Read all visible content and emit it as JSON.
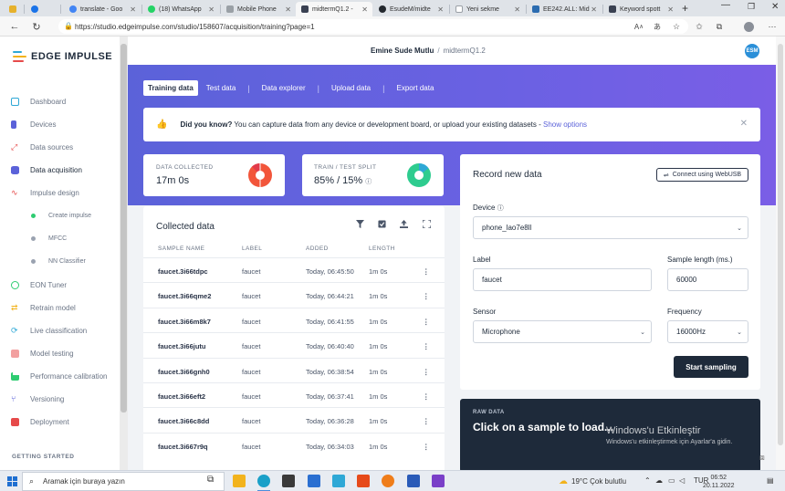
{
  "browser": {
    "tabs": [
      {
        "label": "",
        "color": "#e6b12c"
      },
      {
        "label": "",
        "color": "#1a73e8"
      },
      {
        "label": "translate - Goo",
        "color": "#4285f4"
      },
      {
        "label": "(18) WhatsApp",
        "color": "#25d366"
      },
      {
        "label": "Mobile Phone",
        "color": "#9aa0a6"
      },
      {
        "label": "midtermQ1.2 -",
        "color": "#3a4152"
      },
      {
        "label": "EsudeM/midte",
        "color": "#24292f"
      },
      {
        "label": "Yeni sekme",
        "color": "#9aa0a6"
      },
      {
        "label": "EE242.ALL: Mid",
        "color": "#2b6cb0"
      },
      {
        "label": "Keyword spott",
        "color": "#3a4152"
      }
    ],
    "url": "https://studio.edgeimpulse.com/studio/158607/acquisition/training?page=1"
  },
  "sidebar": {
    "logo_text": "EDGE IMPULSE",
    "items": [
      {
        "label": "Dashboard",
        "color": "#2ea8d6"
      },
      {
        "label": "Devices",
        "color": "#5b62d9"
      },
      {
        "label": "Data sources",
        "color": "#e64a4a"
      },
      {
        "label": "Data acquisition",
        "color": "#5b62d9"
      },
      {
        "label": "Impulse design",
        "color": "#e64a4a"
      }
    ],
    "subitems": [
      {
        "label": "Create impulse",
        "color": "#2ecc71"
      },
      {
        "label": "MFCC",
        "color": "#9aa2b0"
      },
      {
        "label": "NN Classifier",
        "color": "#9aa2b0"
      }
    ],
    "items2": [
      {
        "label": "EON Tuner",
        "color": "#2ecc71"
      },
      {
        "label": "Retrain model",
        "color": "#f2b31d"
      },
      {
        "label": "Live classification",
        "color": "#2ea8d6"
      },
      {
        "label": "Model testing",
        "color": "#e64a4a"
      },
      {
        "label": "Performance calibration",
        "color": "#2ecc71"
      },
      {
        "label": "Versioning",
        "color": "#5b62d9"
      },
      {
        "label": "Deployment",
        "color": "#e64a4a"
      }
    ],
    "getting_started": "GETTING STARTED"
  },
  "header": {
    "user": "Emine Sude Mutlu",
    "separator": "/",
    "project": "midtermQ1.2",
    "avatar": "ESM"
  },
  "subtabs": [
    "Training data",
    "Test data",
    "Data explorer",
    "Upload data",
    "Export data"
  ],
  "tip": {
    "bold": "Did you know?",
    "text": " You can capture data from any device or development board, or upload your existing datasets - ",
    "link": "Show options"
  },
  "stats": {
    "collected_label": "DATA COLLECTED",
    "collected_value": "17m 0s",
    "split_label": "TRAIN / TEST SPLIT",
    "split_value": "85% / 15%",
    "train_fraction": 0.85
  },
  "collected": {
    "title": "Collected data",
    "columns": [
      "SAMPLE NAME",
      "LABEL",
      "ADDED",
      "LENGTH"
    ],
    "rows": [
      {
        "name": "faucet.3i66tdpc",
        "label": "faucet",
        "added": "Today, 06:45:50",
        "length": "1m 0s"
      },
      {
        "name": "faucet.3i66qme2",
        "label": "faucet",
        "added": "Today, 06:44:21",
        "length": "1m 0s"
      },
      {
        "name": "faucet.3i66m8k7",
        "label": "faucet",
        "added": "Today, 06:41:55",
        "length": "1m 0s"
      },
      {
        "name": "faucet.3i66jutu",
        "label": "faucet",
        "added": "Today, 06:40:40",
        "length": "1m 0s"
      },
      {
        "name": "faucet.3i66gnh0",
        "label": "faucet",
        "added": "Today, 06:38:54",
        "length": "1m 0s"
      },
      {
        "name": "faucet.3i66eft2",
        "label": "faucet",
        "added": "Today, 06:37:41",
        "length": "1m 0s"
      },
      {
        "name": "faucet.3i66c8dd",
        "label": "faucet",
        "added": "Today, 06:36:28",
        "length": "1m 0s"
      },
      {
        "name": "faucet.3i667r9q",
        "label": "faucet",
        "added": "Today, 06:34:03",
        "length": "1m 0s"
      }
    ]
  },
  "record": {
    "title": "Record new data",
    "webusb": "Connect using WebUSB",
    "device_label": "Device",
    "device_value": "phone_lao7e8ll",
    "label_label": "Label",
    "label_value": "faucet",
    "length_label": "Sample length (ms.)",
    "length_value": "60000",
    "sensor_label": "Sensor",
    "sensor_value": "Microphone",
    "freq_label": "Frequency",
    "freq_value": "16000Hz",
    "start_button": "Start sampling"
  },
  "raw": {
    "label": "RAW DATA",
    "text": "Click on a sample to load..."
  },
  "watermark": {
    "line1": "Windows'u Etkinleştir",
    "line2": "Windows'u etkinleştirmek için Ayarlar'a gidin."
  },
  "taskbar": {
    "search_placeholder": "Aramak için buraya yazın",
    "weather": "19°C  Çok bulutlu",
    "lang": "TUR",
    "time": "06:52",
    "date": "20.11.2022"
  }
}
